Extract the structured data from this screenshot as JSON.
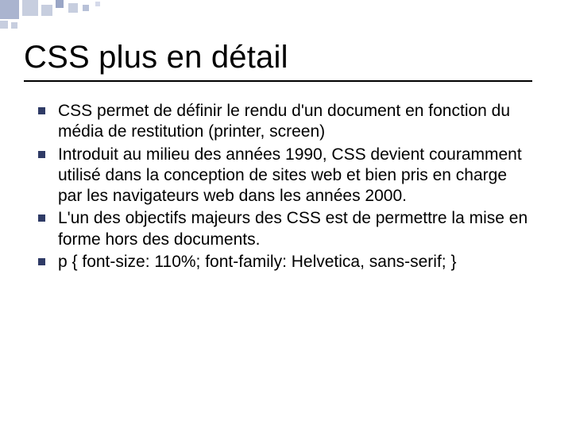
{
  "slide": {
    "title": "CSS plus en détail",
    "bullets": [
      "CSS permet de définir le rendu d'un document en fonction du média de restitution (printer, screen)",
      "Introduit au milieu des années 1990, CSS devient couramment utilisé dans la conception de sites web et bien pris en charge par les navigateurs web dans les années 2000.",
      "L'un des objectifs majeurs des CSS est de permettre la mise en forme hors des documents.",
      "p { font-size: 110%; font-family: Helvetica, sans-serif; }"
    ]
  }
}
